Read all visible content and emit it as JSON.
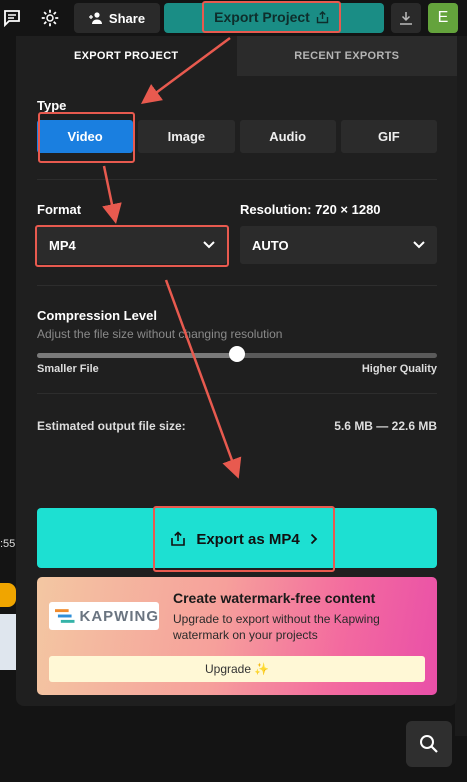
{
  "topbar": {
    "share_label": "Share",
    "export_label": "Export Project",
    "avatar_letter": "E"
  },
  "left_strip": {
    "time_fragment": ":55"
  },
  "tabs": [
    {
      "label": "EXPORT PROJECT",
      "active": true
    },
    {
      "label": "RECENT EXPORTS",
      "active": false
    }
  ],
  "type": {
    "label": "Type",
    "options": [
      "Video",
      "Image",
      "Audio",
      "GIF"
    ],
    "selected": "Video"
  },
  "format": {
    "label": "Format",
    "value": "MP4"
  },
  "resolution": {
    "label": "Resolution: 720 × 1280",
    "value": "AUTO"
  },
  "compression": {
    "label": "Compression Level",
    "hint": "Adjust the file size without changing resolution",
    "min_label": "Smaller File",
    "max_label": "Higher Quality",
    "level_percent": 50
  },
  "estimate": {
    "label": "Estimated output file size:",
    "value": "5.6 MB — 22.6 MB"
  },
  "export_button": {
    "label": "Export as MP4"
  },
  "promo": {
    "logo_text": "KAPWING",
    "title": "Create watermark-free content",
    "text": "Upgrade to export without the Kapwing watermark on your projects",
    "upgrade_label": "Upgrade",
    "upgrade_sparkle": "✨"
  },
  "colors": {
    "accent_teal": "#1de0d2",
    "selected_blue": "#1a7fe0",
    "annotation_red": "#e85a4f",
    "avatar_green": "#64a33c"
  }
}
